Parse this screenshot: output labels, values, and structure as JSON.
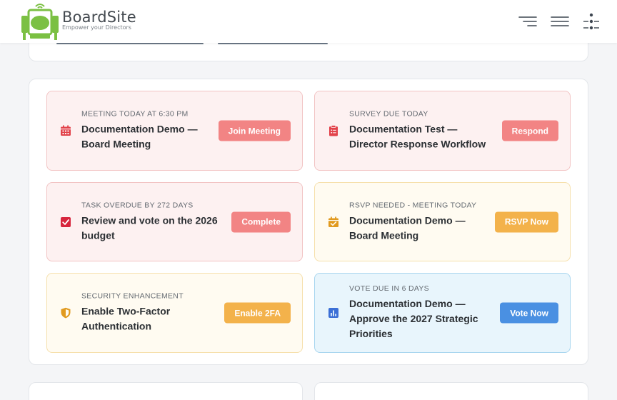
{
  "header": {
    "brand_name": "BoardSite",
    "brand_tagline": "Empower your Directors",
    "icons": [
      "menu-right-icon",
      "menu-icon",
      "more-options-icon"
    ]
  },
  "colors": {
    "red_bg": "#fdf1f1",
    "red_button": "#f28484",
    "yellow_bg": "#fffbf1",
    "yellow_button": "#f3b24b",
    "blue_bg": "#e8f5fc",
    "blue_button": "#4a90e2",
    "logo_green": "#7bc043"
  },
  "alerts": [
    {
      "label": "Meeting Today at 6:30 PM",
      "title": "Documentation Demo —\nBoard Meeting",
      "button": "Join Meeting",
      "icon": "calendar-icon",
      "tone": "red"
    },
    {
      "label": "Survey Due Today",
      "title": "Documentation Test —\nDirector Response Workflow",
      "button": "Respond",
      "icon": "clipboard-icon",
      "tone": "red"
    },
    {
      "label": "Task Overdue by 272 Days",
      "title": "Review and vote on the 2026\nbudget",
      "button": "Complete",
      "icon": "checkbox-icon",
      "tone": "red"
    },
    {
      "label": "RSVP Needed - Meeting Today",
      "title": "Documentation Demo —\nBoard Meeting",
      "button": "RSVP Now",
      "icon": "calendar-check-icon",
      "tone": "yellow"
    },
    {
      "label": "Security Enhancement",
      "title": "Enable Two-Factor\nAuthentication",
      "button": "Enable 2FA",
      "icon": "shield-icon",
      "tone": "yellow"
    },
    {
      "label": "Vote Due in 6 Days",
      "title": "Documentation Demo —\nApprove the 2027 Strategic\nPriorities",
      "button": "Vote Now",
      "icon": "bar-chart-icon",
      "tone": "blue"
    }
  ]
}
